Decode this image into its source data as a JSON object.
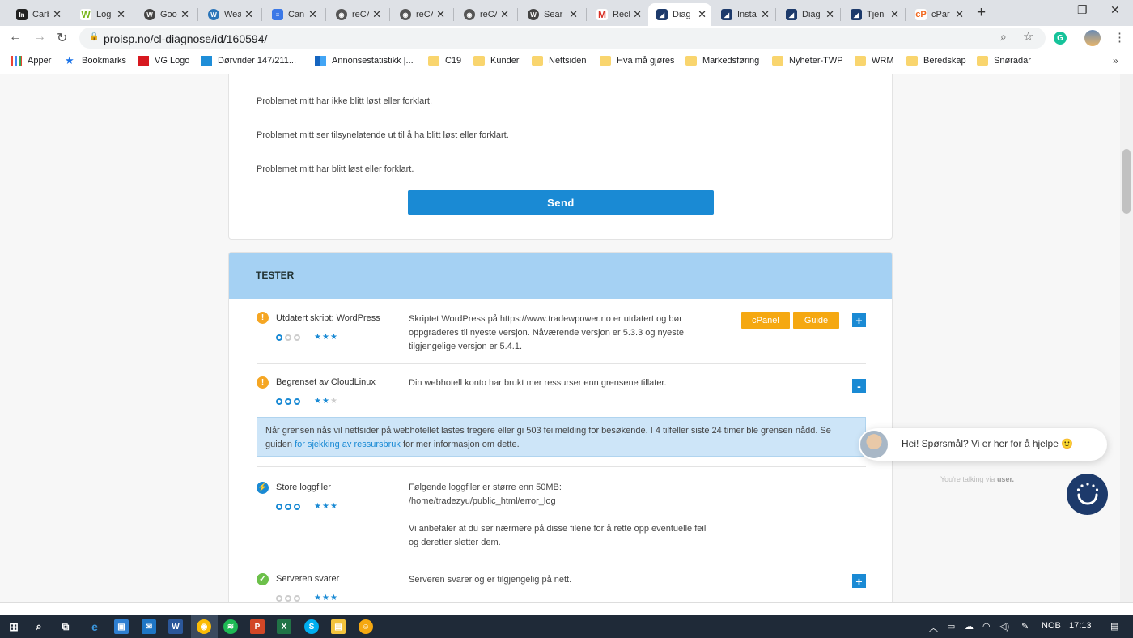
{
  "browser": {
    "tabs": [
      {
        "label": "Carb",
        "icon": "invisionapp-icon",
        "color": "#222"
      },
      {
        "label": "Log",
        "icon": "w-logo-icon",
        "color": "#7ab51d"
      },
      {
        "label": "Goo",
        "icon": "wordpress-icon",
        "color": "#444"
      },
      {
        "label": "Wea",
        "icon": "wordpress-icon",
        "color": "#2a74b8"
      },
      {
        "label": "Canı",
        "icon": "docs-icon",
        "color": "#3b78e7"
      },
      {
        "label": "reCA",
        "icon": "globe-icon",
        "color": "#555"
      },
      {
        "label": "reCA",
        "icon": "globe-icon",
        "color": "#555"
      },
      {
        "label": "reCA",
        "icon": "globe-icon",
        "color": "#555"
      },
      {
        "label": "Sear",
        "icon": "wordpress-icon",
        "color": "#444"
      },
      {
        "label": "Recl",
        "icon": "gmail-icon",
        "color": "#d93025"
      },
      {
        "label": "Diag",
        "icon": "proisp-icon",
        "color": "#1d3a6b",
        "active": true
      },
      {
        "label": "Insta",
        "icon": "proisp-icon",
        "color": "#1d3a6b"
      },
      {
        "label": "Diag",
        "icon": "proisp-icon",
        "color": "#1d3a6b"
      },
      {
        "label": "Tjen",
        "icon": "proisp-icon",
        "color": "#1d3a6b"
      },
      {
        "label": "cPar",
        "icon": "cpanel-icon",
        "color": "#f26a21"
      }
    ],
    "url": "proisp.no/cl-diagnose/id/160594/",
    "bookmarks": [
      {
        "label": "Apper",
        "icon": "apps-grid-icon"
      },
      {
        "label": "Bookmarks",
        "icon": "star-icon"
      },
      {
        "label": "VG Logo",
        "icon": "vg-icon"
      },
      {
        "label": "Dørvrider 147/211...",
        "icon": "link-icon"
      },
      {
        "label": "Annonsestatistikk |...",
        "icon": "chart-icon"
      },
      {
        "label": "C19",
        "icon": "folder-icon"
      },
      {
        "label": "Kunder",
        "icon": "folder-icon"
      },
      {
        "label": "Nettsiden",
        "icon": "folder-icon"
      },
      {
        "label": "Hva må gjøres",
        "icon": "folder-icon"
      },
      {
        "label": "Markedsføring",
        "icon": "folder-icon"
      },
      {
        "label": "Nyheter-TWP",
        "icon": "folder-icon"
      },
      {
        "label": "WRM",
        "icon": "folder-icon"
      },
      {
        "label": "Beredskap",
        "icon": "folder-icon"
      },
      {
        "label": "Snøradar",
        "icon": "folder-icon"
      }
    ],
    "bookmarks_more": "»"
  },
  "feedback": {
    "options": [
      "Problemet mitt har ikke blitt løst eller forklart.",
      "Problemet mitt ser tilsynelatende ut til å ha blitt løst eller forklart.",
      "Problemet mitt har blitt løst eller forklart."
    ],
    "send_label": "Send"
  },
  "tests": {
    "title": "TESTER",
    "rows": [
      {
        "status": "warning",
        "title": "Utdatert skript: WordPress",
        "circles": 1,
        "stars": 3,
        "description": "Skriptet WordPress på https://www.tradewpower.no er utdatert og bør oppgraderes til nyeste versjon. Nåværende versjon er 5.3.3 og nyeste tilgjengelige versjon er 5.4.1.",
        "button1": "cPanel",
        "button2": "Guide",
        "toggle": "+"
      },
      {
        "status": "warning",
        "title": "Begrenset av CloudLinux",
        "circles": 3,
        "stars": 2,
        "description": "Din webhotell konto har brukt mer ressurser enn grensene tillater.",
        "toggle": "-",
        "expanded_before": "Når grensen nås vil nettsider på webhotellet lastes tregere eller gi 503 feilmelding for besøkende. I 4 tilfeller siste 24 timer ble grensen nådd. Se guiden ",
        "expanded_link": "for sjekking av ressursbruk",
        "expanded_after": " for mer informasjon om dette."
      },
      {
        "status": "info",
        "title": "Store loggfiler",
        "circles": 3,
        "stars": 3,
        "description": "Følgende loggfiler er større enn 50MB:",
        "path": "/home/tradezyu/public_html/error_log",
        "description2": "Vi anbefaler at du ser nærmere på disse filene for å rette opp eventuelle feil og deretter sletter dem."
      },
      {
        "status": "ok",
        "title": "Serveren svarer",
        "circles": 0,
        "stars": 3,
        "description": "Serveren svarer og er tilgjengelig på nett.",
        "toggle": "+"
      }
    ]
  },
  "chat": {
    "message": "Hei! Spørsmål? Vi er her for å hjelpe 🙂",
    "footer_prefix": "You're talking via ",
    "footer_bold": "user."
  },
  "taskbar": {
    "language": "NOB",
    "time": "17:13"
  },
  "colors": {
    "accent": "#1a8ad4",
    "tester_header": "#a5d1f3",
    "orange_button": "#f5a811",
    "warning": "#f5a623",
    "ok": "#6cc04a"
  }
}
